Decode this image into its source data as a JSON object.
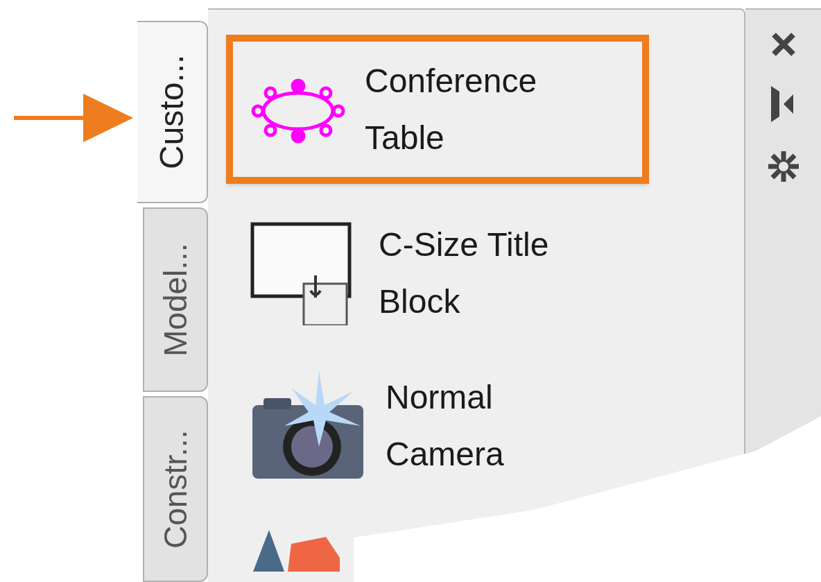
{
  "tabs": [
    {
      "label": "Custo...",
      "selected": true
    },
    {
      "label": "Model...",
      "selected": false
    },
    {
      "label": "Constr...",
      "selected": false
    }
  ],
  "items": [
    {
      "kind": "conference",
      "label": "Conference\nTable",
      "highlighted": true
    },
    {
      "kind": "titleblock",
      "label": "C-Size Title\nBlock",
      "highlighted": false
    },
    {
      "kind": "camera",
      "label": "Normal\nCamera",
      "highlighted": false
    },
    {
      "kind": "shapes",
      "highlighted": false
    }
  ]
}
